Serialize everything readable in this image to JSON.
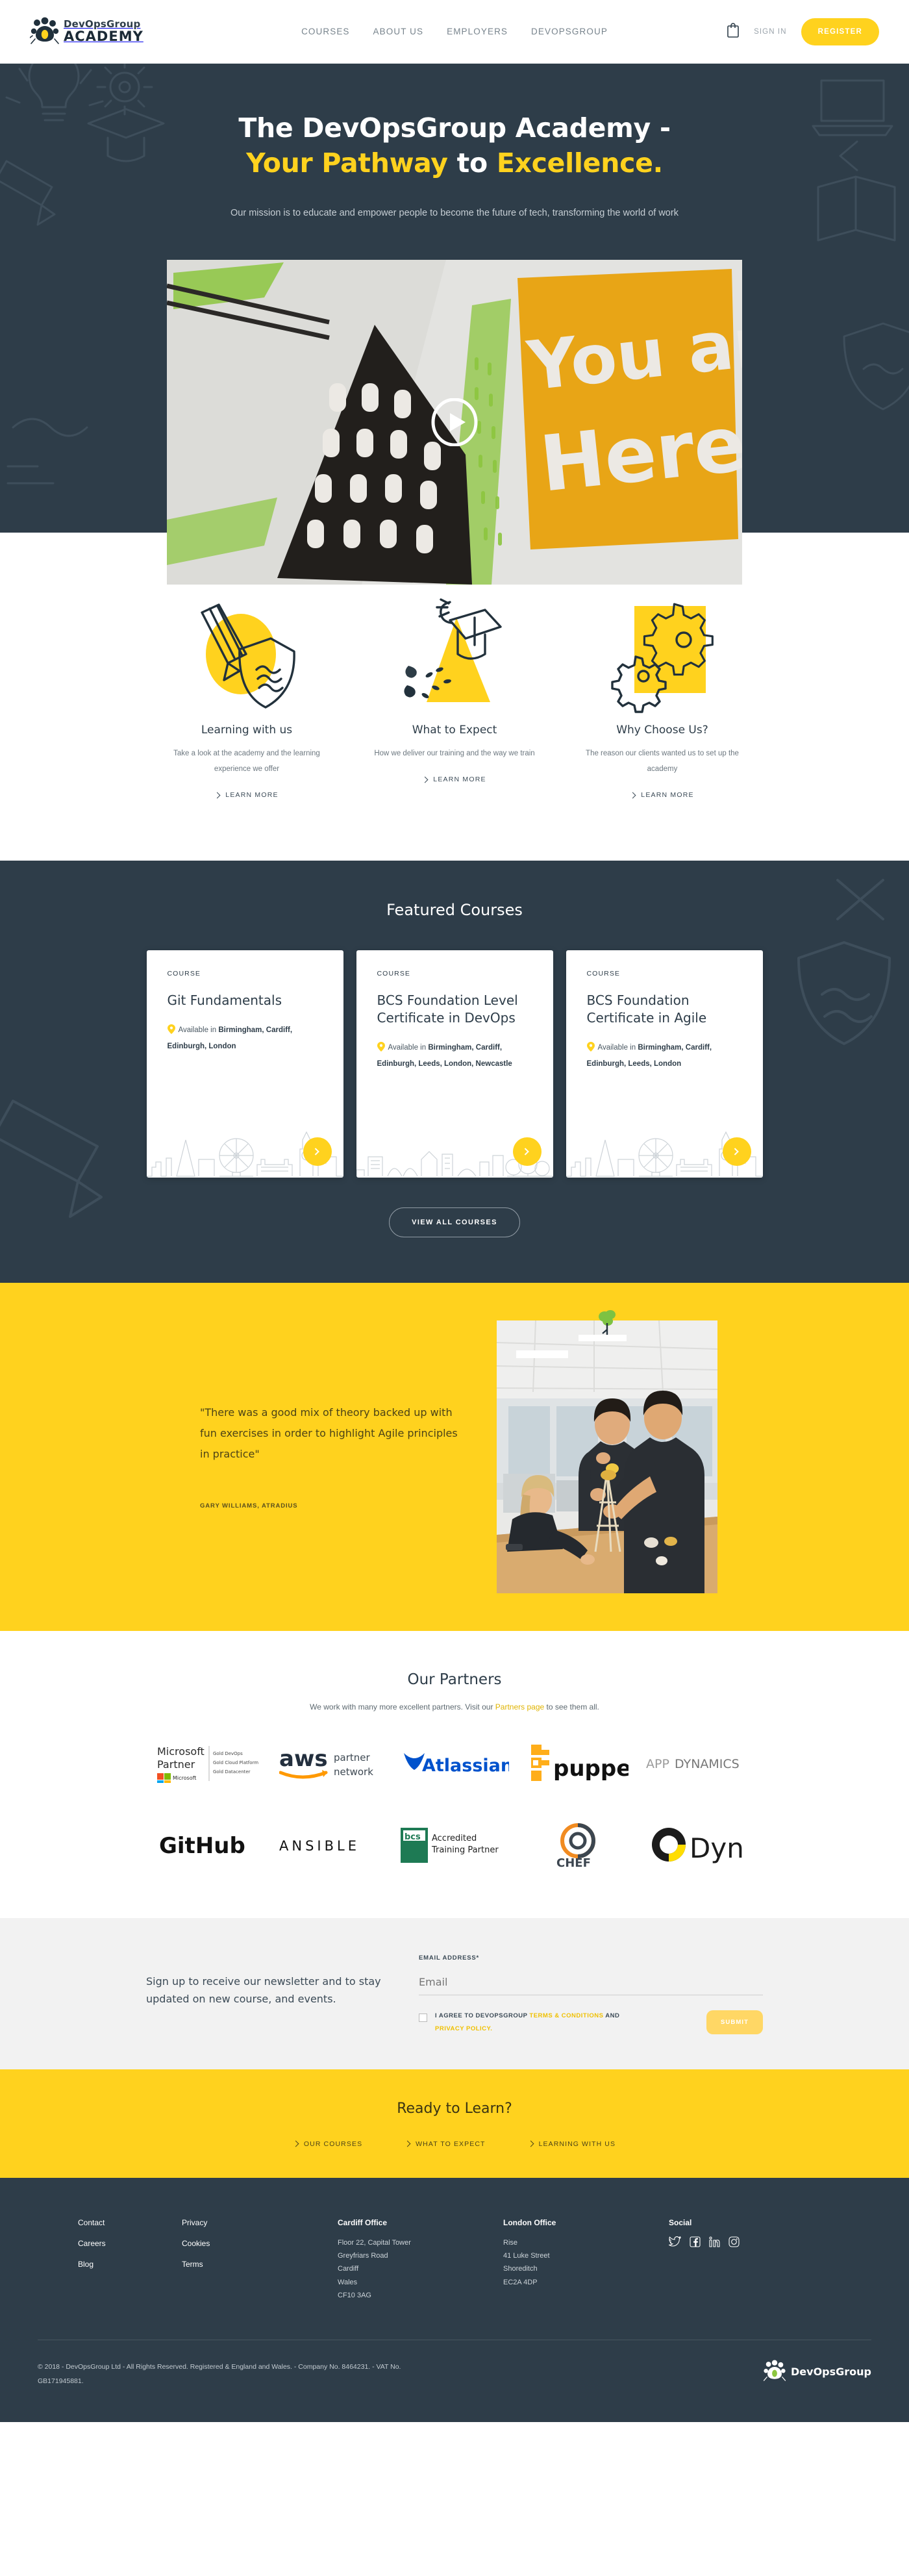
{
  "header": {
    "logo_top": "DevOpsGroup",
    "logo_bottom": "ACADEMY",
    "nav": [
      {
        "label": "COURSES"
      },
      {
        "label": "ABOUT US"
      },
      {
        "label": "EMPLOYERS"
      },
      {
        "label": "DEVOPSGROUP"
      }
    ],
    "cart_icon": "shopping-bag-icon",
    "signin_label": "SIGN IN",
    "register_label": "REGISTER"
  },
  "hero": {
    "title_line1": "The DevOpsGroup Academy -",
    "title_line2_a": "Your Pathway ",
    "title_line2_b": "to ",
    "title_line2_c": "Excellence.",
    "subtitle": "Our mission is to educate and empower people to become the future of tech, transforming the world of work",
    "video_overlay_text_1": "You are",
    "video_overlay_text_2": "Here!",
    "play_icon": "play-icon"
  },
  "features": [
    {
      "icon": "pencil-shield-icon",
      "title": "Learning with us",
      "desc": "Take a look at the academy and the learning experience we offer",
      "link": "LEARN MORE"
    },
    {
      "icon": "graduation-cap-icon",
      "title": "What to Expect",
      "desc": "How we deliver our training and the way we train",
      "link": "LEARN MORE"
    },
    {
      "icon": "gears-icon",
      "title": "Why Choose Us?",
      "desc": "The reason our clients wanted us to set up the academy",
      "link": "LEARN MORE"
    }
  ],
  "courses": {
    "title": "Featured Courses",
    "cards": [
      {
        "label": "COURSE",
        "name": "Git Fundamentals",
        "available_prefix": "Available in ",
        "locations": "Birmingham, Cardiff, Edinburgh, London",
        "arrow_icon": "chevron-right-icon"
      },
      {
        "label": "COURSE",
        "name": "BCS Foundation Level Certificate in DevOps",
        "available_prefix": "Available in ",
        "locations": "Birmingham, Cardiff, Edinburgh, Leeds, London, Newcastle",
        "arrow_icon": "chevron-right-icon"
      },
      {
        "label": "COURSE",
        "name": "BCS Foundation Certificate in Agile",
        "available_prefix": "Available in ",
        "locations": "Birmingham, Cardiff, Edinburgh, Leeds, London",
        "arrow_icon": "chevron-right-icon"
      }
    ],
    "view_all_label": "VIEW ALL COURSES"
  },
  "quote": {
    "text": "\"There was a good mix of theory backed up with fun exercises in order to highlight Agile principles in practice\"",
    "author": "GARY WILLIAMS, ATRADIUS",
    "sprout_icon": "sprout-icon"
  },
  "partners": {
    "title": "Our Partners",
    "sub_before": "We work with many more excellent partners. Visit our ",
    "sub_link": "Partners page",
    "sub_after": " to see them all.",
    "row1": [
      {
        "name": "microsoft-partner-logo",
        "text": "Microsoft Partner",
        "sub": "Gold DevOps / Gold Cloud Platform / Gold Datacenter"
      },
      {
        "name": "aws-partner-network-logo",
        "text": "aws partner network"
      },
      {
        "name": "atlassian-logo",
        "text": "Atlassian"
      },
      {
        "name": "puppet-logo",
        "text": "puppet"
      },
      {
        "name": "appdynamics-logo",
        "text": "APPDYNAMICS"
      }
    ],
    "row2": [
      {
        "name": "github-logo",
        "text": "GitHub"
      },
      {
        "name": "ansible-logo",
        "text": "ANSIBLE"
      },
      {
        "name": "bcs-accredited-training-partner-logo",
        "text": "bcs Accredited Training Partner"
      },
      {
        "name": "chef-logo",
        "text": "CHEF"
      },
      {
        "name": "dyn-logo",
        "text": "Dyn"
      }
    ]
  },
  "newsletter": {
    "copy": "Sign up to receive our newsletter and to stay updated on new course, and events.",
    "email_label": "EMAIL ADDRESS*",
    "email_placeholder": "Email",
    "terms_1": "I AGREE TO DEVOPSGROUP ",
    "terms_link_1": "TERMS & CONDITIONS",
    "terms_2": " AND ",
    "terms_link_2": "PRIVACY POLICY.",
    "submit_label": "SUBMIT"
  },
  "ready": {
    "title": "Ready to Learn?",
    "links": [
      {
        "label": "OUR COURSES"
      },
      {
        "label": "WHAT TO EXPECT"
      },
      {
        "label": "LEARNING WITH US"
      }
    ]
  },
  "footer": {
    "col1": [
      {
        "label": "Contact"
      },
      {
        "label": "Careers"
      },
      {
        "label": "Blog"
      }
    ],
    "col2": [
      {
        "label": "Privacy"
      },
      {
        "label": "Cookies"
      },
      {
        "label": "Terms"
      }
    ],
    "cardiff_head": "Cardiff Office",
    "cardiff_addr": "Floor 22, Capital Tower\nGreyfriars Road\nCardiff\nWales\nCF10 3AG",
    "london_head": "London Office",
    "london_addr": "Rise\n41 Luke Street\nShoreditch\nEC2A 4DP",
    "social_head": "Social",
    "socials": [
      {
        "name": "twitter-icon"
      },
      {
        "name": "facebook-icon"
      },
      {
        "name": "linkedin-icon"
      },
      {
        "name": "instagram-icon"
      }
    ],
    "copyright": "© 2018 - DevOpsGroup Ltd - All Rights Reserved. Registered & England and Wales. - Company No. 8464231. - VAT No. GB171945881.",
    "logo_text": "DevOpsGroup"
  },
  "colors": {
    "dark": "#2e3d49",
    "yellow": "#ffd21e",
    "light_grey": "#f2f2f2",
    "white": "#ffffff"
  }
}
